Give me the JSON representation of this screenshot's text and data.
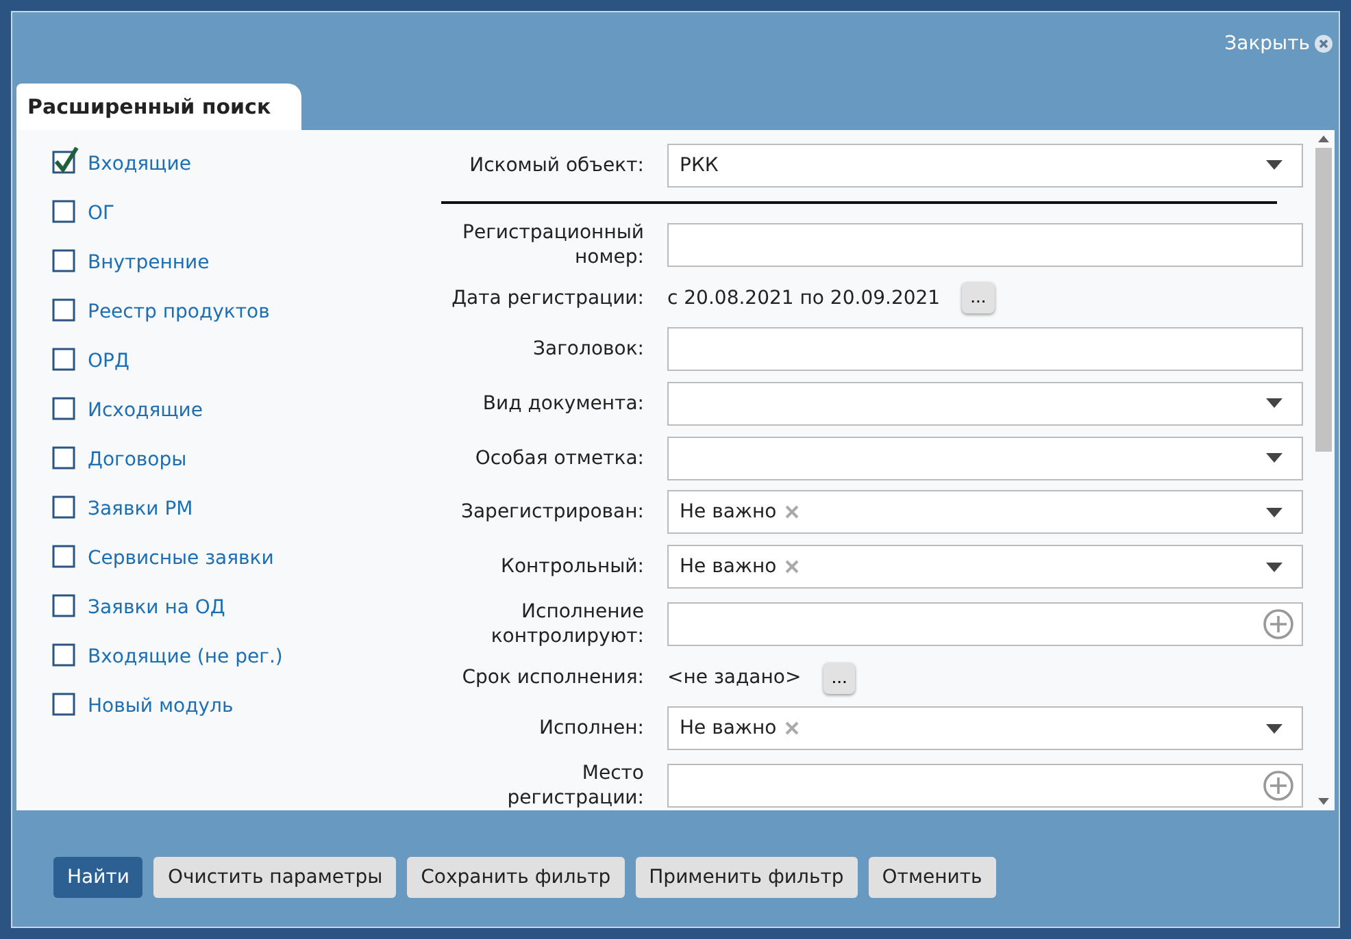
{
  "dialog": {
    "close_label": "Закрыть"
  },
  "tabs": [
    {
      "label": "Расширенный поиск",
      "selected": true
    }
  ],
  "modules": [
    {
      "label": "Входящие",
      "checked": true
    },
    {
      "label": "ОГ",
      "checked": false
    },
    {
      "label": "Внутренние",
      "checked": false
    },
    {
      "label": "Реестр продуктов",
      "checked": false
    },
    {
      "label": "ОРД",
      "checked": false
    },
    {
      "label": "Исходящие",
      "checked": false
    },
    {
      "label": "Договоры",
      "checked": false
    },
    {
      "label": "Заявки РМ",
      "checked": false
    },
    {
      "label": "Сервисные заявки",
      "checked": false
    },
    {
      "label": "Заявки на ОД",
      "checked": false
    },
    {
      "label": "Входящие (не рег.)",
      "checked": false
    },
    {
      "label": "Новый модуль",
      "checked": false
    }
  ],
  "object_field": {
    "label": "Искомый объект:",
    "value": "РКК"
  },
  "fields": [
    {
      "kind": "text",
      "label": "Регистрационный номер:"
    },
    {
      "kind": "range",
      "label": "Дата регистрации:",
      "value": "с 20.08.2021 по 20.09.2021",
      "button": "..."
    },
    {
      "kind": "text",
      "label": "Заголовок:"
    },
    {
      "kind": "select",
      "label": "Вид документа:"
    },
    {
      "kind": "select",
      "label": "Особая отметка:"
    },
    {
      "kind": "select",
      "label": "Зарегистрирован:",
      "value": "Не важно",
      "clearable": true
    },
    {
      "kind": "select",
      "label": "Контрольный:",
      "value": "Не важно",
      "clearable": true
    },
    {
      "kind": "lookup",
      "label": "Исполнение контролируют:"
    },
    {
      "kind": "range",
      "label": "Срок исполнения:",
      "value": "<не задано>",
      "button": "..."
    },
    {
      "kind": "select",
      "label": "Исполнен:",
      "value": "Не важно",
      "clearable": true
    },
    {
      "kind": "lookup",
      "label": "Место регистрации:"
    }
  ],
  "buttons": [
    {
      "label": "Найти",
      "kind": "primary"
    },
    {
      "label": "Очистить параметры",
      "kind": "default"
    },
    {
      "label": "Сохранить фильтр",
      "kind": "default"
    },
    {
      "label": "Применить фильтр",
      "kind": "default"
    },
    {
      "label": "Отменить",
      "kind": "default"
    }
  ]
}
